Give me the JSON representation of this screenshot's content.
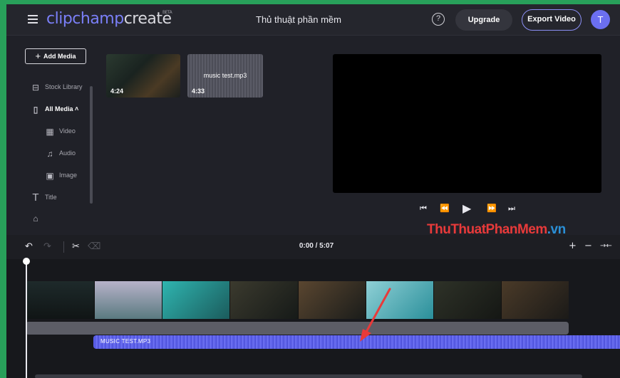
{
  "header": {
    "logo_clip": "clipchamp",
    "logo_create": "create",
    "logo_beta": "BETA",
    "project_title": "Thủ thuật phần mềm",
    "help_symbol": "?",
    "upgrade_label": "Upgrade",
    "export_label": "Export Video",
    "avatar_initial": "T"
  },
  "sidebar": {
    "add_media_label": "Add Media",
    "items": [
      {
        "label": "Stock Library",
        "icon": "store-icon"
      },
      {
        "label": "All Media",
        "icon": "file-icon",
        "chevron": "˄"
      },
      {
        "label": "Video",
        "icon": "film-icon"
      },
      {
        "label": "Audio",
        "icon": "music-icon"
      },
      {
        "label": "Image",
        "icon": "image-icon"
      },
      {
        "label": "Title",
        "icon": "text-icon"
      }
    ]
  },
  "media": [
    {
      "duration": "4:24",
      "name": ""
    },
    {
      "duration": "4:33",
      "name": "music test.mp3"
    }
  ],
  "watermark": {
    "part1": "ThuThuat",
    "part2": "PhanMem",
    "part3": ".vn"
  },
  "timeline": {
    "time_display": "0:00 / 5:07",
    "audio_clip_label": "MUSIC TEST.MP3"
  },
  "colors": {
    "accent": "#7a7ff7",
    "frame_border": "#28a05a",
    "audio_track": "#5c60e8",
    "arrow": "#e83a3a"
  }
}
